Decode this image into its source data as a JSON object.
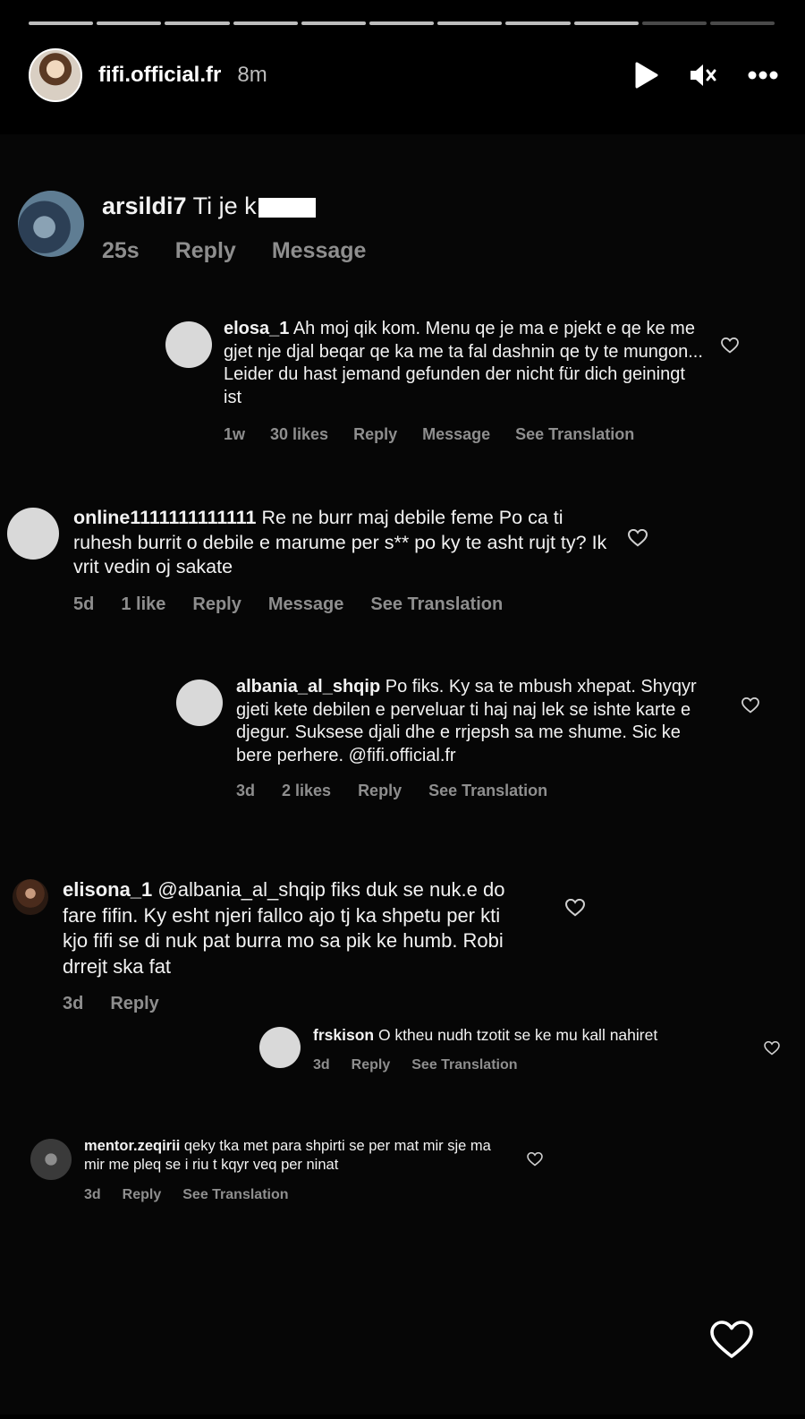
{
  "story": {
    "progress_segments": 11,
    "progress_seen": 9,
    "username": "fifi.official.fr",
    "time": "8m",
    "controls": [
      "play-icon",
      "mute-icon",
      "more-icon"
    ]
  },
  "comments": [
    {
      "user": "arsildi7",
      "text": "Ti je k",
      "meta": {
        "time": "25s",
        "reply": "Reply",
        "message": "Message"
      }
    },
    {
      "user": "elosa_1",
      "text": "Ah moj qik kom. Menu qe je ma e pjekt e qe ke me gjet nje djal beqar qe ka me ta fal dashnin qe ty te mungon... Leider du hast jemand gefunden der nicht für dich geiningt ist",
      "meta": {
        "time": "1w",
        "likes": "30 likes",
        "reply": "Reply",
        "message": "Message",
        "translate": "See Translation"
      }
    },
    {
      "user": "online1111111111111",
      "text": "Re ne burr maj debile feme Po ca ti ruhesh burrit o debile e marume per s** po ky te asht rujt ty? Ik vrit vedin oj sakate",
      "meta": {
        "time": "5d",
        "likes": "1 like",
        "reply": "Reply",
        "message": "Message",
        "translate": "See Translation"
      }
    },
    {
      "user": "albania_al_shqip",
      "text": "Po fiks. Ky sa te mbush xhepat. Shyqyr gjeti kete debilen e perveluar ti haj naj lek se ishte karte e djegur. Suksese djali dhe e rrjepsh sa me shume. Sic ke bere perhere. @fifi.official.fr",
      "meta": {
        "time": "3d",
        "likes": "2 likes",
        "reply": "Reply",
        "translate": "See Translation"
      }
    },
    {
      "user": "elisona_1",
      "text": "@albania_al_shqip  fiks duk se nuk.e do fare fifin.  Ky esht njeri fallco ajo tj ka shpetu per kti kjo fifi se di  nuk pat burra mo sa pik ke humb.  Robi drrejt ska fat",
      "meta": {
        "time": "3d",
        "reply": "Reply"
      }
    },
    {
      "user": "frskison",
      "text": "O ktheu nudh tzotit se ke mu kall nahiret",
      "meta": {
        "time": "3d",
        "reply": "Reply",
        "translate": "See Translation"
      }
    },
    {
      "user": "mentor.zeqirii",
      "text": "qeky tka met para shpirti se per mat mir sje ma mir me pleq se i riu t kqyr veq per ninat",
      "meta": {
        "time": "3d",
        "reply": "Reply",
        "translate": "See Translation"
      }
    }
  ]
}
